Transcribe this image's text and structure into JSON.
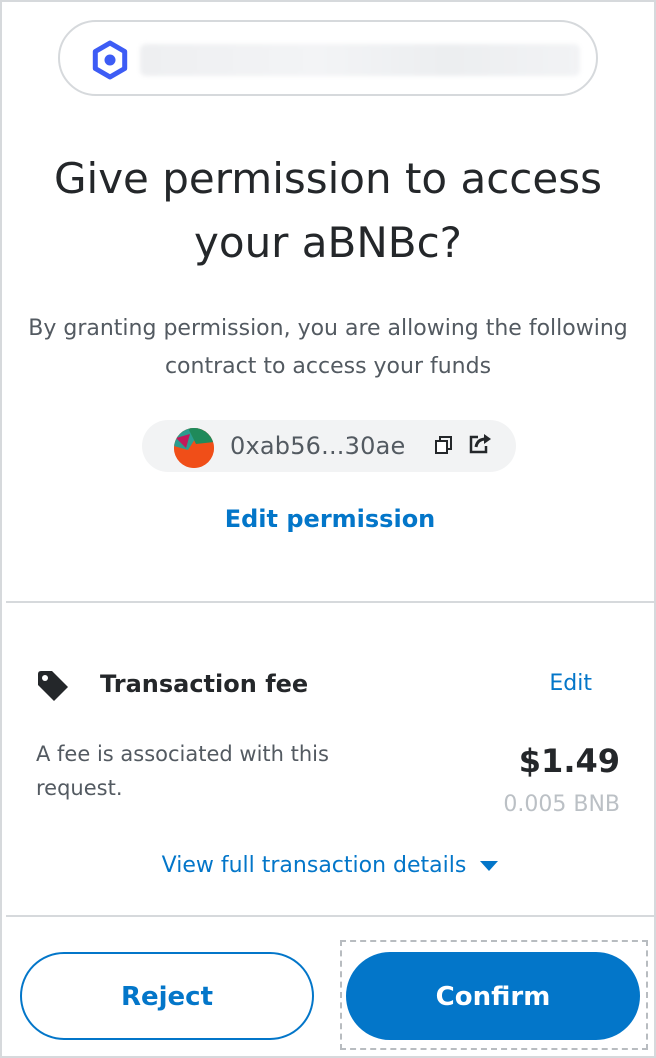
{
  "origin": {
    "icon": "site-favicon-icon"
  },
  "title": "Give permission to access your aBNBc?",
  "subtitle": "By granting permission, you are allowing the following contract to access your funds",
  "contract": {
    "address": "0xab56...30ae",
    "copy_icon": "copy-icon",
    "share_icon": "share-icon"
  },
  "edit_permission_label": "Edit permission",
  "fee": {
    "icon": "tag-icon",
    "label": "Transaction fee",
    "edit_label": "Edit",
    "description": "A fee is associated with this request.",
    "amount_usd": "$1.49",
    "amount_native": "0.005 BNB"
  },
  "details_link": "View full transaction details",
  "buttons": {
    "reject": "Reject",
    "confirm": "Confirm"
  },
  "colors": {
    "primary": "#0376c9",
    "text": "#24272a",
    "muted": "#535a61",
    "border": "#d6d9dc"
  }
}
